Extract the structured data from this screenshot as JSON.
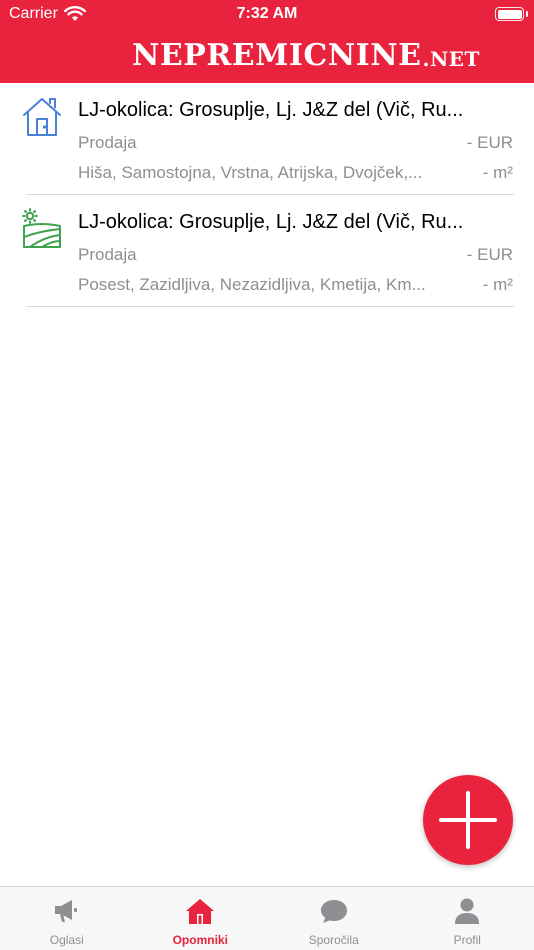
{
  "status_bar": {
    "carrier": "Carrier",
    "time": "7:32 AM"
  },
  "header": {
    "brand_main": "NEPREMICNINE",
    "brand_suffix": ".NET"
  },
  "colors": {
    "accent": "#e9233d",
    "house_icon": "#4a7fd6",
    "land_icon": "#3fa34d",
    "secondary_text": "#8e8e93",
    "tab_inactive": "#8e8e93"
  },
  "reminders": [
    {
      "icon": "house-icon",
      "title": "LJ-okolica: Grosuplje, Lj. J&Z del (Vič, Ru...",
      "type": "Prodaja",
      "price": "- EUR",
      "tags": "Hiša, Samostojna, Vrstna, Atrijska, Dvojček,...",
      "area": "- m²"
    },
    {
      "icon": "land-icon",
      "title": "LJ-okolica: Grosuplje, Lj. J&Z del (Vič, Ru...",
      "type": "Prodaja",
      "price": "- EUR",
      "tags": "Posest, Zazidljiva, Nezazidljiva, Kmetija, Km...",
      "area": "- m²"
    }
  ],
  "fab": {
    "icon": "plus-icon"
  },
  "tabs": [
    {
      "label": "Oglasi",
      "icon": "megaphone-icon",
      "active": false
    },
    {
      "label": "Opomniki",
      "icon": "home-icon",
      "active": true
    },
    {
      "label": "Sporočila",
      "icon": "chat-bubble-icon",
      "active": false
    },
    {
      "label": "Profil",
      "icon": "person-icon",
      "active": false
    }
  ]
}
